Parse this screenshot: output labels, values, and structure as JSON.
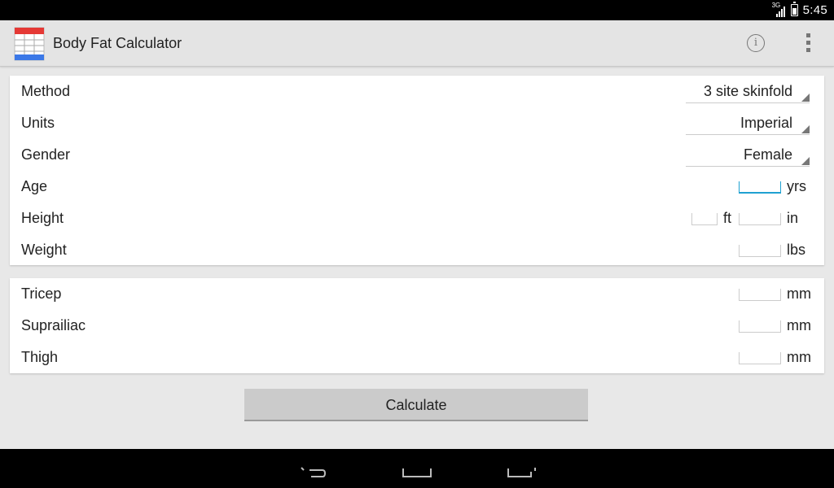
{
  "status_bar": {
    "network": "3G",
    "time": "5:45"
  },
  "action_bar": {
    "title": "Body Fat Calculator",
    "info_glyph": "i"
  },
  "form": {
    "method": {
      "label": "Method",
      "value": "3 site skinfold"
    },
    "units": {
      "label": "Units",
      "value": "Imperial"
    },
    "gender": {
      "label": "Gender",
      "value": "Female"
    },
    "age": {
      "label": "Age",
      "value": "",
      "unit": "yrs"
    },
    "height": {
      "label": "Height",
      "ft_value": "",
      "ft_unit": "ft",
      "in_value": "",
      "in_unit": "in"
    },
    "weight": {
      "label": "Weight",
      "value": "",
      "unit": "lbs"
    }
  },
  "skinfolds": [
    {
      "label": "Tricep",
      "value": "",
      "unit": "mm"
    },
    {
      "label": "Suprailiac",
      "value": "",
      "unit": "mm"
    },
    {
      "label": "Thigh",
      "value": "",
      "unit": "mm"
    }
  ],
  "calculate_label": "Calculate",
  "colors": {
    "accent": "#1fa1d1",
    "icon_red": "#e53935",
    "icon_blue": "#3b78e7"
  },
  "icons": {
    "app": "app-table-icon",
    "info": "info-icon",
    "overflow": "overflow-menu-icon",
    "back": "back-icon",
    "home": "home-icon",
    "recents": "recents-icon"
  }
}
